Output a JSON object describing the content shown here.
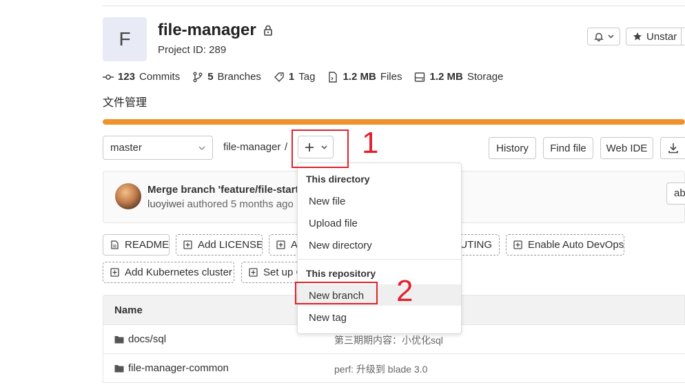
{
  "project": {
    "avatar_letter": "F",
    "name": "file-manager",
    "id_text": "Project ID: 289",
    "description": "文件管理"
  },
  "header_buttons": {
    "unstar_label": "Unstar"
  },
  "stats": [
    {
      "icon": "commit-icon",
      "count": "123",
      "label": "Commits"
    },
    {
      "icon": "branch-icon",
      "count": "5",
      "label": "Branches"
    },
    {
      "icon": "tag-icon",
      "count": "1",
      "label": "Tag"
    },
    {
      "icon": "file-icon",
      "count": "1.2 MB",
      "label": "Files"
    },
    {
      "icon": "storage-icon",
      "count": "1.2 MB",
      "label": "Storage"
    }
  ],
  "language_bar": {
    "fill_percent": 100,
    "color": "#f0922c"
  },
  "repo_nav": {
    "branch": "master",
    "breadcrumb": "file-manager",
    "separator": "/",
    "history_label": "History",
    "find_file_label": "Find file",
    "web_ide_label": "Web IDE"
  },
  "last_commit": {
    "title": "Merge branch 'feature/file-starte",
    "author": "luoyiwei",
    "meta": "authored 5 months ago",
    "sha_partial": "ab"
  },
  "quick_actions": {
    "readme": "README",
    "add_license": "Add LICENSE",
    "add_changelog_partial": "A",
    "contributing_partial": "BUTING",
    "enable_auto_devops": "Enable Auto DevOps",
    "add_k8s": "Add Kubernetes cluster",
    "set_up_ci_partial": "Set up C"
  },
  "table": {
    "name_header": "Name",
    "rows": [
      {
        "name": "docs/sql",
        "message": "第三期期内容：小优化sql"
      },
      {
        "name": "file-manager-common",
        "message": "perf: 升级到 blade 3.0"
      }
    ]
  },
  "dropdown": {
    "section1_header": "This directory",
    "new_file": "New file",
    "upload_file": "Upload file",
    "new_directory": "New directory",
    "section2_header": "This repository",
    "new_branch": "New branch",
    "new_tag": "New tag"
  },
  "annotations": {
    "step1": "1",
    "step2": "2",
    "color": "#e3202b"
  }
}
